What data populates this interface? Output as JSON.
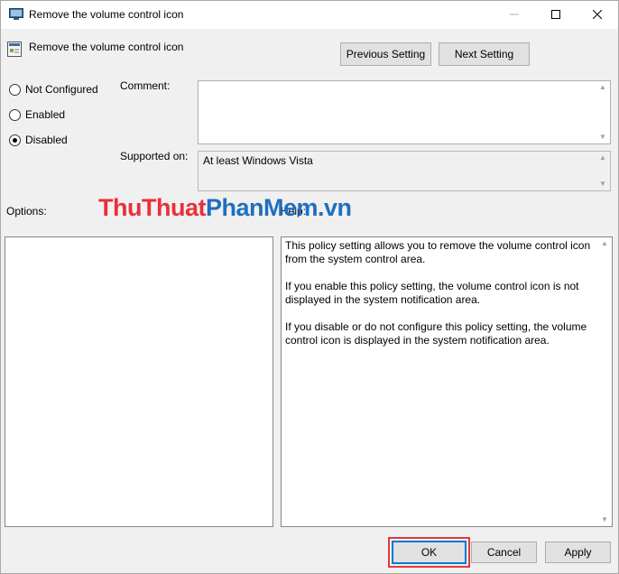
{
  "window": {
    "title": "Remove the volume control icon",
    "minimize_icon": "minimize-icon",
    "maximize_icon": "maximize-icon",
    "close_icon": "close-icon"
  },
  "header": {
    "title": "Remove the volume control icon",
    "prev_label": "Previous Setting",
    "next_label": "Next Setting"
  },
  "state": {
    "options": [
      {
        "label": "Not Configured",
        "selected": false
      },
      {
        "label": "Enabled",
        "selected": false
      },
      {
        "label": "Disabled",
        "selected": true
      }
    ]
  },
  "comment": {
    "label": "Comment:",
    "value": ""
  },
  "supported": {
    "label": "Supported on:",
    "value": "At least Windows Vista"
  },
  "options_label": "Options:",
  "help_label": "Help:",
  "watermark": {
    "part1": "Thu",
    "part2": "Thuat",
    "part3": "Phan",
    "part4": "Mem",
    "part5": ".vn"
  },
  "help": {
    "paragraphs": [
      "This policy setting allows you to remove the volume control icon from the system control area.",
      "If you enable this policy setting, the volume control icon is not displayed in the system notification area.",
      "If you disable or do not configure this policy setting, the volume control icon is displayed in the system notification area."
    ]
  },
  "footer": {
    "ok_label": "OK",
    "cancel_label": "Cancel",
    "apply_label": "Apply"
  },
  "colors": {
    "focus_highlight": "#e03a3e",
    "default_button_border": "#0078d7"
  }
}
